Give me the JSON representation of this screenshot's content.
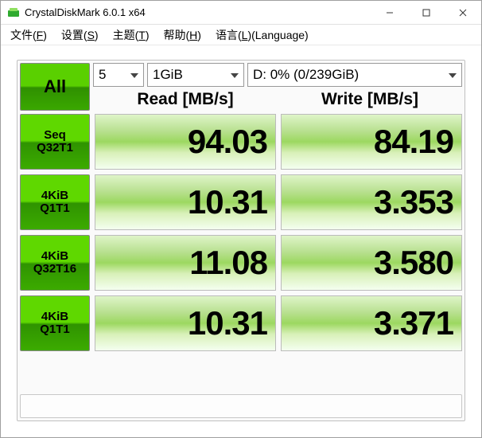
{
  "window": {
    "title": "CrystalDiskMark 6.0.1 x64"
  },
  "menu": {
    "file": "文件",
    "file_u": "F",
    "setting": "设置",
    "setting_u": "S",
    "theme": "主题",
    "theme_u": "T",
    "help": "帮助",
    "help_u": "H",
    "lang": "语言",
    "lang_u": "L",
    "lang_suffix": "(Language)"
  },
  "controls": {
    "all_label": "All",
    "pass_value": "5",
    "size_value": "1GiB",
    "drive_value": "D: 0% (0/239GiB)"
  },
  "headers": {
    "read": "Read [MB/s]",
    "write": "Write [MB/s]"
  },
  "rows": [
    {
      "label1": "Seq",
      "label2": "Q32T1",
      "read": "94.03",
      "write": "84.19"
    },
    {
      "label1": "4KiB",
      "label2": "Q1T1",
      "read": "10.31",
      "write": "3.353"
    },
    {
      "label1": "4KiB",
      "label2": "Q32T16",
      "read": "11.08",
      "write": "3.580"
    },
    {
      "label1": "4KiB",
      "label2": "Q1T1",
      "read": "10.31",
      "write": "3.371"
    }
  ]
}
